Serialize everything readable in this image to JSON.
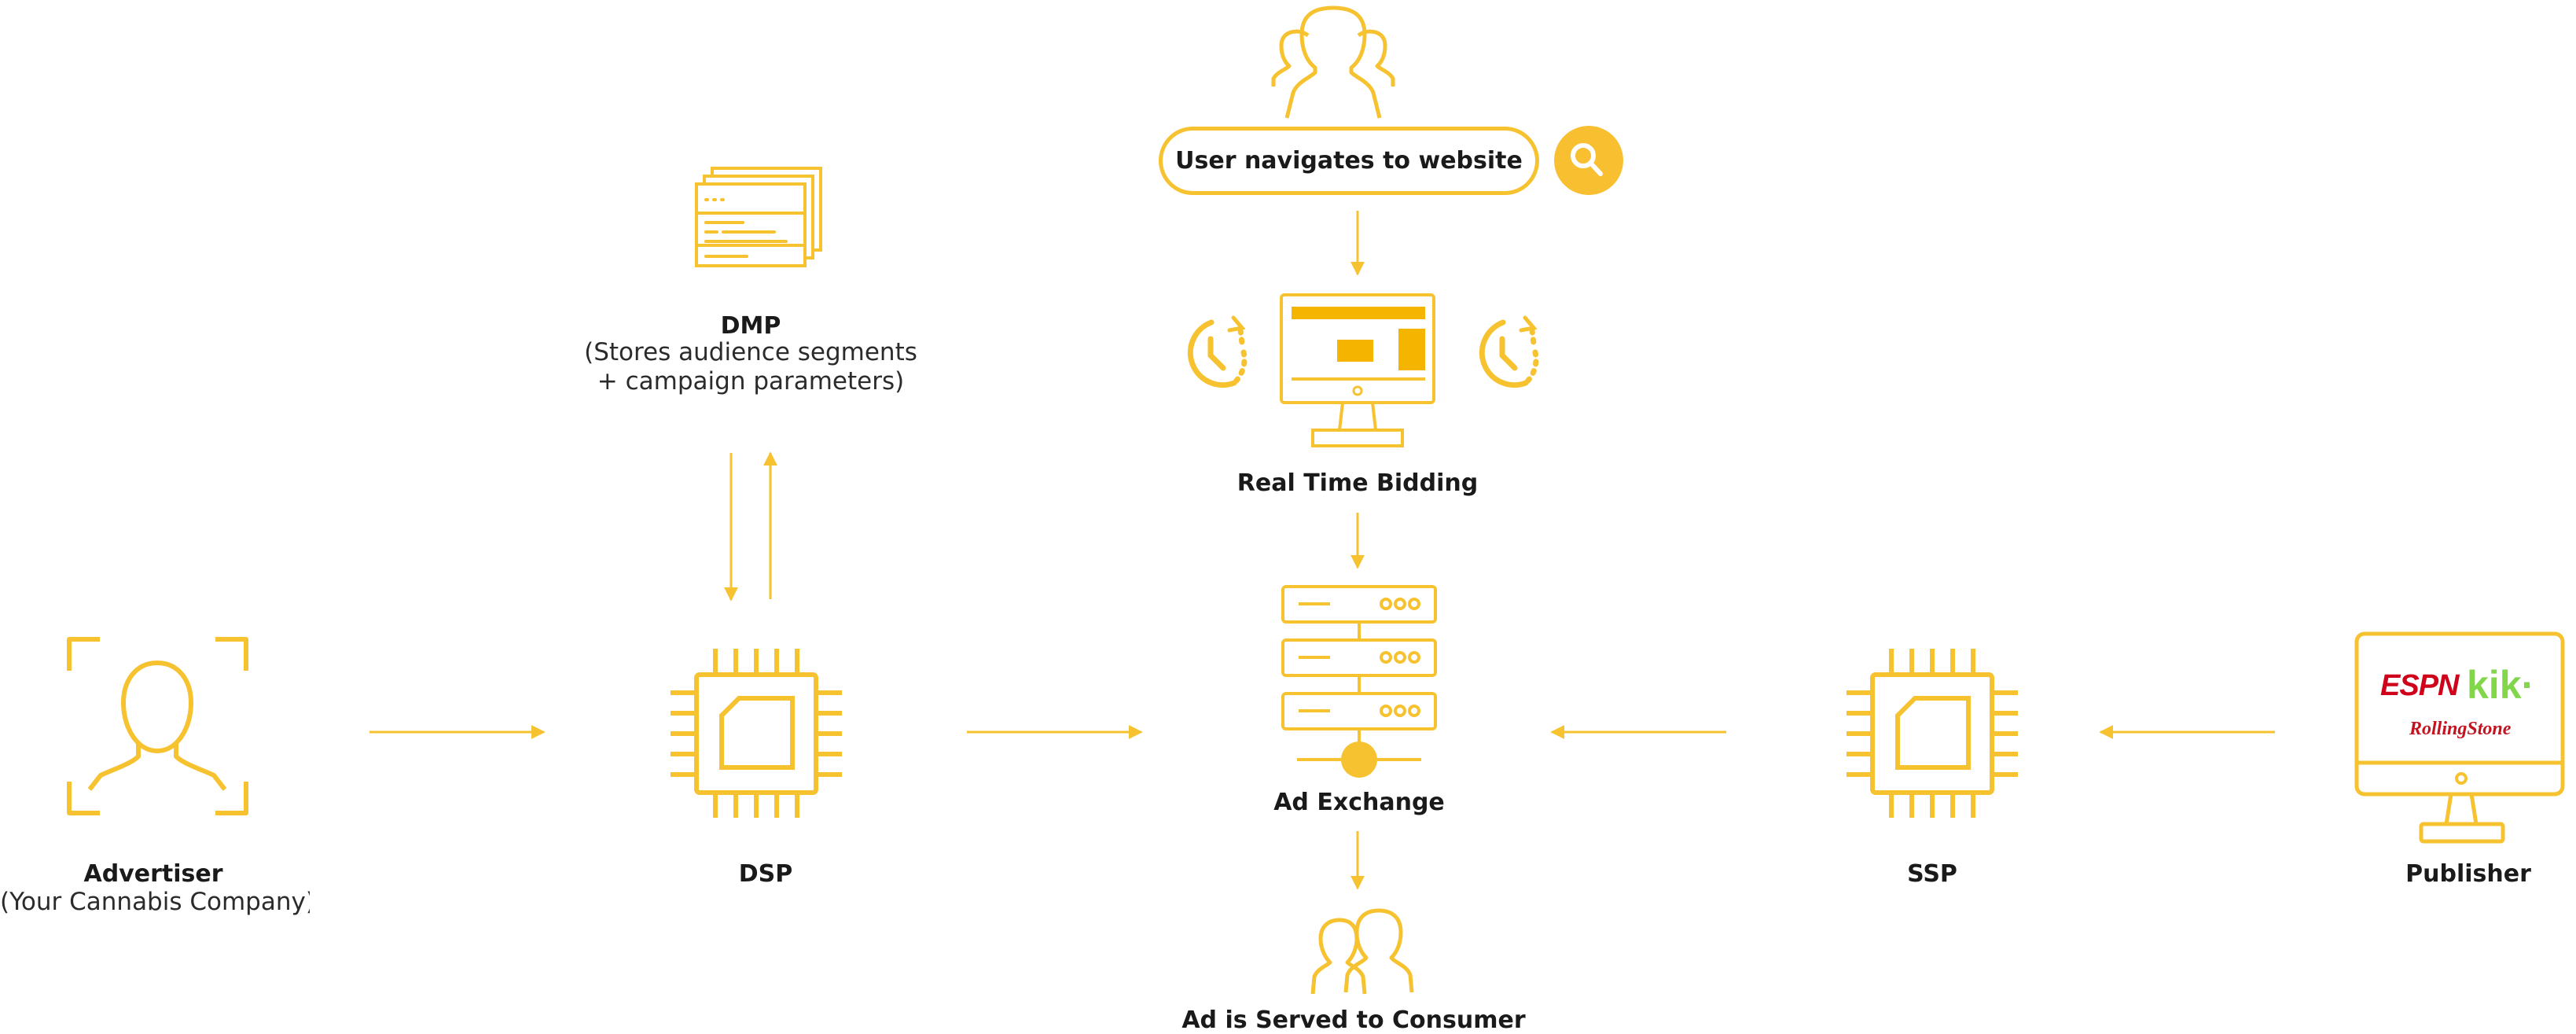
{
  "colors": {
    "accent": "#f7c230",
    "accent_dark": "#f4b400",
    "logo_red": "#d0021b",
    "logo_green": "#82d64a",
    "text": "#1a1a1a"
  },
  "nodes": {
    "user_search": {
      "label": "User navigates to website",
      "icons": [
        "users-group-icon",
        "search-icon"
      ]
    },
    "dmp": {
      "title": "DMP",
      "desc_line1": "(Stores audience segments",
      "desc_line2": "+ campaign parameters)",
      "icon": "documents-stack-icon"
    },
    "rtb": {
      "title": "Real Time Bidding",
      "icons": [
        "clock-icon",
        "monitor-icon",
        "clock-icon"
      ]
    },
    "advertiser": {
      "title": "Advertiser",
      "subtitle": "(Your Cannabis Company)",
      "icon": "face-scan-icon"
    },
    "dsp": {
      "title": "DSP",
      "icon": "chip-icon"
    },
    "ad_exchange": {
      "title": "Ad Exchange",
      "icon": "server-stack-icon"
    },
    "ssp": {
      "title": "SSP",
      "icon": "chip-icon"
    },
    "publisher": {
      "title": "Publisher",
      "icon": "monitor-logos-icon",
      "logos": [
        "ESPN",
        "kik·",
        "RollingStone"
      ]
    },
    "consumer": {
      "title": "Ad is Served to Consumer",
      "icon": "users-pair-icon"
    }
  }
}
